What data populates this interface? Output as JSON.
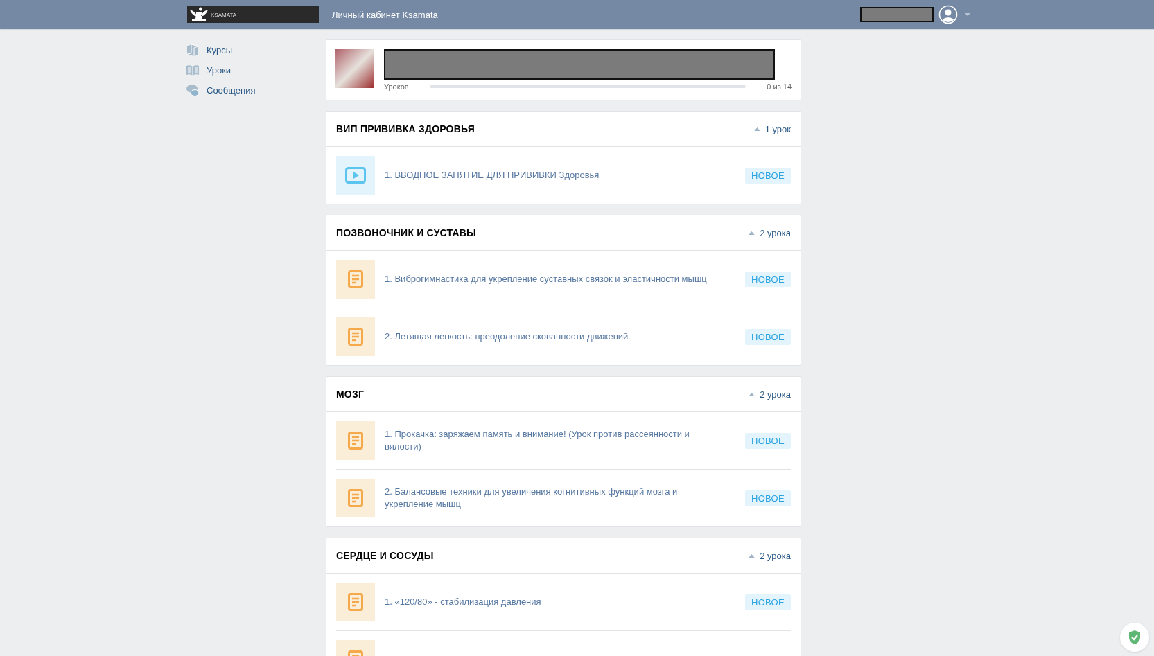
{
  "header": {
    "logo_text": "KSAMATA",
    "title": "Личный кабинет Ksamata"
  },
  "sidebar": {
    "items": [
      {
        "kind": "courses",
        "label": "Курсы"
      },
      {
        "kind": "lessons",
        "label": "Уроки"
      },
      {
        "kind": "messages",
        "label": "Сообщения"
      }
    ]
  },
  "course": {
    "progress_label": "Уроков",
    "progress": {
      "level": 0
    },
    "progress_text": "0 из 14"
  },
  "sections": [
    {
      "title": "ВИП ПРИВИВКА ЗДОРОВЬЯ",
      "count": "1 урок",
      "expanded": true,
      "lessons": [
        {
          "kind": "video",
          "title": "1. ВВОДНОЕ ЗАНЯТИЕ ДЛЯ ПРИВИВКИ Здоровья",
          "badge": "НОВОЕ"
        }
      ]
    },
    {
      "title": "ПОЗВОНОЧНИК И СУСТАВЫ",
      "count": "2 урока",
      "expanded": true,
      "lessons": [
        {
          "kind": "text",
          "title": "1. Виброгимнастика для укрепление суставных связок и эластичности мышц",
          "badge": "НОВОЕ"
        },
        {
          "kind": "text",
          "title": "2. Летящая легкость: преодоление скованности движений",
          "badge": "НОВОЕ"
        }
      ]
    },
    {
      "title": "МОЗГ",
      "count": "2 урока",
      "expanded": true,
      "lessons": [
        {
          "kind": "text",
          "title": "1. Прокачка: заряжаем память и внимание! (Урок против рассеянности и вялости)",
          "badge": "НОВОЕ"
        },
        {
          "kind": "text",
          "title": "2. Балансовые техники для увеличения когнитивных функций мозга и укрепление мышц",
          "badge": "НОВОЕ"
        }
      ]
    },
    {
      "title": "СЕРДЦЕ И СОСУДЫ",
      "count": "2 урока",
      "expanded": true,
      "lessons": [
        {
          "kind": "text",
          "title": "1. «120/80» - стабилизация давления",
          "badge": "НОВОЕ"
        },
        {
          "kind": "text"
        }
      ]
    }
  ]
}
